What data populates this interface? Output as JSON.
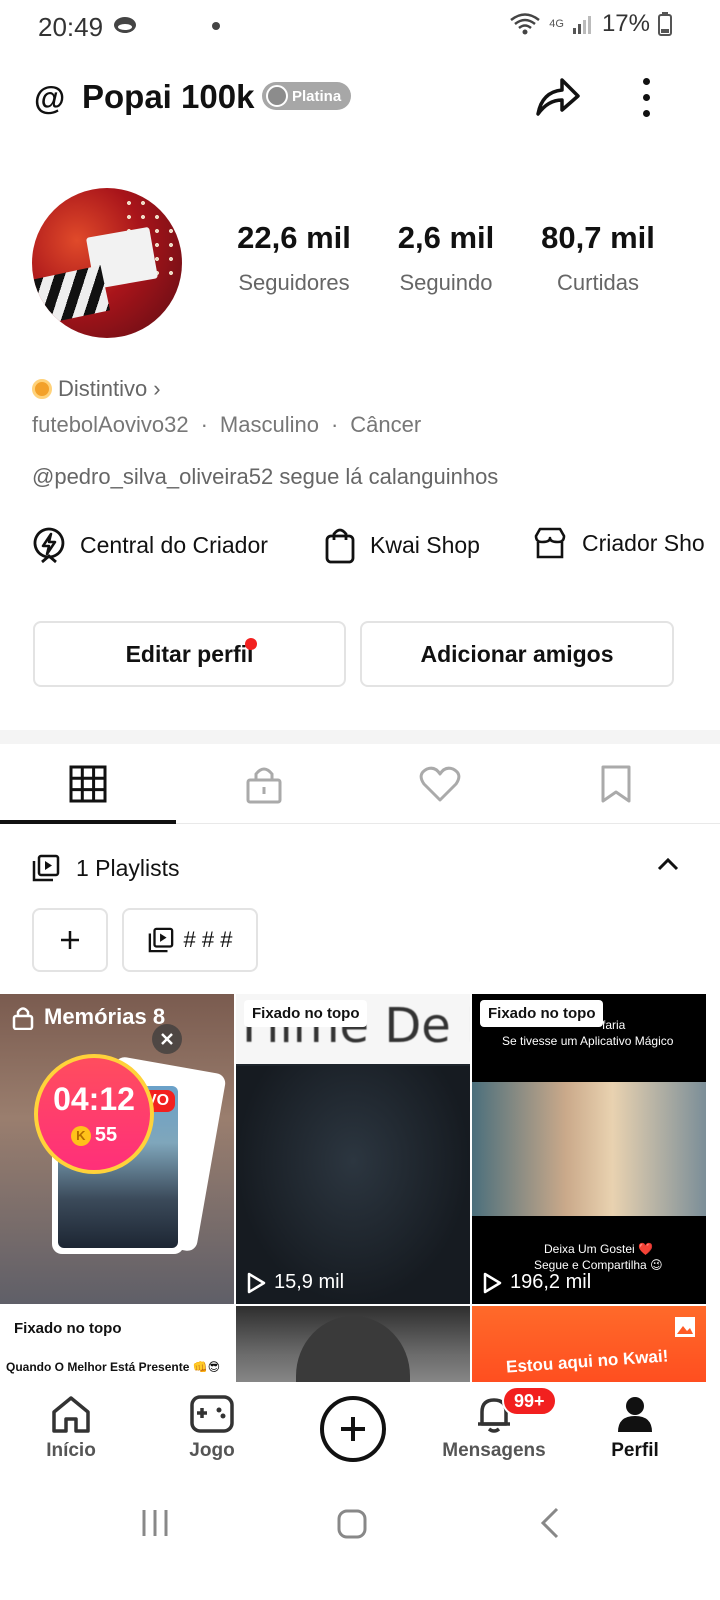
{
  "status_bar": {
    "time": "20:49",
    "battery": "17%",
    "network": "4G"
  },
  "header": {
    "username": "Popai 100k",
    "badge": "Platina"
  },
  "stats": [
    {
      "value": "22,6 mil",
      "label": "Seguidores"
    },
    {
      "value": "2,6 mil",
      "label": "Seguindo"
    },
    {
      "value": "80,7 mil",
      "label": "Curtidas"
    }
  ],
  "profile": {
    "distintivo": "Distintivo",
    "handle": "futebolAovivo32",
    "gender": "Masculino",
    "sign": "Câncer",
    "separator": "·",
    "bio": "@pedro_silva_oliveira52 segue lá calanguinhos"
  },
  "links": [
    {
      "label": "Central do Criador",
      "icon": "lightning-icon"
    },
    {
      "label": "Kwai Shop",
      "icon": "shopping-bag-icon"
    },
    {
      "label": "Criador Sho",
      "icon": "store-icon"
    }
  ],
  "actions": {
    "edit_profile": "Editar perfil",
    "add_friends": "Adicionar amigos"
  },
  "tabs": [
    {
      "name": "grid-icon",
      "active": true
    },
    {
      "name": "lock-icon",
      "active": false
    },
    {
      "name": "heart-icon",
      "active": false
    },
    {
      "name": "bookmark-icon",
      "active": false
    }
  ],
  "playlists": {
    "title": "1 Playlists",
    "items": [
      {
        "label": "# # #"
      }
    ]
  },
  "videos": [
    {
      "title": "Memórias 8",
      "timer": "04:12",
      "coins": "55",
      "live_tag": "VO"
    },
    {
      "pinned": "Fixado no topo",
      "overlay": "Filme De R",
      "views": "15,9 mil"
    },
    {
      "pinned": "Fixado no topo",
      "caption_top": "faria",
      "caption_top2": "Se tivesse um Aplicativo Mágico",
      "caption_bottom": "Deixa Um Gostei ❤️",
      "caption_bottom2": "Segue e Compartilha 😉",
      "views": "196,2 mil"
    },
    {
      "pinned": "Fixado no topo",
      "caption": "Quando O Melhor Está Presente 👊😎"
    },
    {},
    {
      "caption": "Estou aqui no Kwai!"
    }
  ],
  "bottom_nav": [
    {
      "label": "Início",
      "icon": "home-icon"
    },
    {
      "label": "Jogo",
      "icon": "gamepad-icon"
    },
    {
      "label": "",
      "icon": "create-icon"
    },
    {
      "label": "Mensagens",
      "icon": "bell-icon"
    },
    {
      "label": "Perfil",
      "icon": "person-icon"
    }
  ],
  "messages_badge": "99+",
  "colors": {
    "accent_red": "#f2201f",
    "text_primary": "#111111",
    "text_secondary": "#666666"
  }
}
